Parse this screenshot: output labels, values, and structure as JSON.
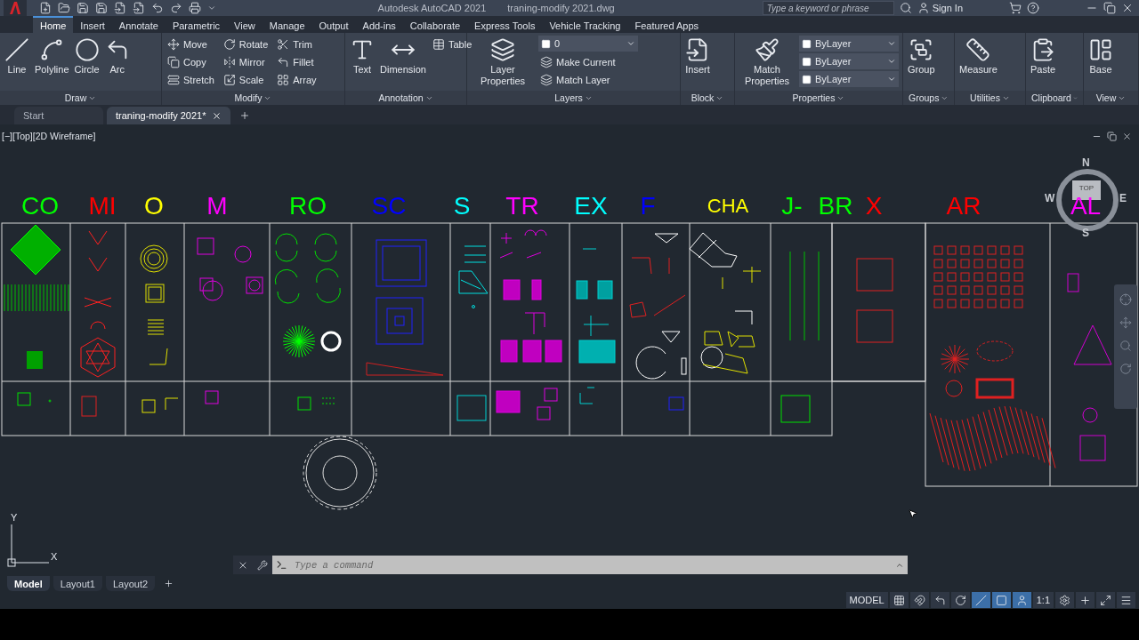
{
  "title_bar": {
    "app": "Autodesk AutoCAD 2021",
    "file": "traning-modify 2021.dwg",
    "search_placeholder": "Type a keyword or phrase",
    "sign_in": "Sign In"
  },
  "ribbon_tabs": [
    {
      "label": "Home",
      "selected": true
    },
    {
      "label": "Insert",
      "selected": false
    },
    {
      "label": "Annotate",
      "selected": false
    },
    {
      "label": "Parametric",
      "selected": false
    },
    {
      "label": "View",
      "selected": false
    },
    {
      "label": "Manage",
      "selected": false
    },
    {
      "label": "Output",
      "selected": false
    },
    {
      "label": "Add-ins",
      "selected": false
    },
    {
      "label": "Collaborate",
      "selected": false
    },
    {
      "label": "Express Tools",
      "selected": false
    },
    {
      "label": "Vehicle Tracking",
      "selected": false
    },
    {
      "label": "Featured Apps",
      "selected": false
    }
  ],
  "ribbon_panels": [
    {
      "title": "Draw",
      "tools": [
        {
          "kind": "large",
          "label": "Line"
        },
        {
          "kind": "large",
          "label": "Polyline"
        },
        {
          "kind": "large",
          "label": "Circle"
        },
        {
          "kind": "large",
          "label": "Arc"
        }
      ]
    },
    {
      "title": "Modify",
      "tools": [
        {
          "kind": "small",
          "label": "Move"
        },
        {
          "kind": "small",
          "label": "Copy"
        },
        {
          "kind": "small",
          "label": "Stretch"
        },
        {
          "kind": "small",
          "label": "Rotate"
        },
        {
          "kind": "small",
          "label": "Mirror"
        },
        {
          "kind": "small",
          "label": "Scale"
        },
        {
          "kind": "small",
          "label": "Trim"
        },
        {
          "kind": "small",
          "label": "Fillet"
        },
        {
          "kind": "small",
          "label": "Array"
        }
      ]
    },
    {
      "title": "Annotation",
      "tools": [
        {
          "kind": "large",
          "label": "Text"
        },
        {
          "kind": "large",
          "label": "Dimension"
        },
        {
          "kind": "small",
          "label": "Table"
        }
      ]
    },
    {
      "title": "Layers",
      "tools": [
        {
          "kind": "large",
          "label": "Layer Properties"
        },
        {
          "kind": "dropdown",
          "value": "0"
        },
        {
          "kind": "small",
          "label": "Make Current"
        },
        {
          "kind": "small",
          "label": "Match Layer"
        }
      ]
    },
    {
      "title": "Block",
      "tools": [
        {
          "kind": "large",
          "label": "Insert"
        }
      ]
    },
    {
      "title": "Properties",
      "tools": [
        {
          "kind": "large",
          "label": "Match Properties"
        },
        {
          "kind": "dropdown",
          "value": "ByLayer"
        },
        {
          "kind": "dropdown",
          "value": "ByLayer"
        },
        {
          "kind": "dropdown",
          "value": "ByLayer"
        }
      ]
    },
    {
      "title": "Groups",
      "tools": [
        {
          "kind": "large",
          "label": "Group"
        }
      ]
    },
    {
      "title": "Utilities",
      "tools": [
        {
          "kind": "large",
          "label": "Measure"
        }
      ]
    },
    {
      "title": "Clipboard",
      "tools": [
        {
          "kind": "large",
          "label": "Paste"
        }
      ]
    },
    {
      "title": "View",
      "tools": [
        {
          "kind": "large",
          "label": "Base"
        }
      ]
    }
  ],
  "doc_tabs": [
    {
      "label": "Start",
      "selected": false
    },
    {
      "label": "traning-modify 2021*",
      "selected": true
    }
  ],
  "viewport": {
    "label": "[−][Top][2D Wireframe]",
    "viewcube": {
      "north": "N",
      "west": "W",
      "east": "E",
      "south": "S",
      "face": "TOP"
    },
    "labels": [
      {
        "text": "CO",
        "color": "#00ff00"
      },
      {
        "text": "MI",
        "color": "#ff0000"
      },
      {
        "text": "O",
        "color": "#ffff00"
      },
      {
        "text": "M",
        "color": "#ff00ff"
      },
      {
        "text": "RO",
        "color": "#00ff00"
      },
      {
        "text": "SC",
        "color": "#0000ff"
      },
      {
        "text": "S",
        "color": "#00ffff"
      },
      {
        "text": "TR",
        "color": "#ff00ff"
      },
      {
        "text": "EX",
        "color": "#00ffff"
      },
      {
        "text": "F",
        "color": "#0000ff"
      },
      {
        "text": "CHA",
        "color": "#ffff00"
      },
      {
        "text": "J-",
        "color": "#00ff00"
      },
      {
        "text": "BR",
        "color": "#00ff00"
      },
      {
        "text": "X",
        "color": "#ff0000"
      },
      {
        "text": "AR",
        "color": "#ff0000"
      },
      {
        "text": "AL",
        "color": "#ff00ff"
      }
    ],
    "ucs": {
      "y": "Y",
      "x": "X"
    }
  },
  "command_line": {
    "placeholder": "Type a command"
  },
  "layout_tabs": [
    {
      "label": "Model",
      "selected": true
    },
    {
      "label": "Layout1",
      "selected": false
    },
    {
      "label": "Layout2",
      "selected": false
    }
  ],
  "status_bar": {
    "mode": "MODEL",
    "scale": "1:1"
  }
}
